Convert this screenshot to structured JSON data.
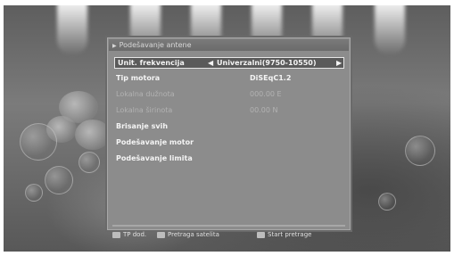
{
  "dialog": {
    "title": "Podešavanje antene"
  },
  "rows": [
    {
      "label": "Unit. frekvencija",
      "value": "Univerzalni(9750-10550)",
      "state": "selected"
    },
    {
      "label": "Tip motora",
      "value": "DiSEqC1.2",
      "state": "normal"
    },
    {
      "label": "Lokalna dužnota",
      "value": "000.00 E",
      "state": "disabled"
    },
    {
      "label": "Lokalna širinota",
      "value": "00.00 N",
      "state": "disabled"
    },
    {
      "label": "Brisanje svih",
      "value": "",
      "state": "normal"
    },
    {
      "label": "Podešavanje motor",
      "value": "",
      "state": "normal"
    },
    {
      "label": "Podešavanje limita",
      "value": "",
      "state": "normal"
    }
  ],
  "footer": {
    "tp_label": "TP dod.",
    "sat_label": "Pretraga satelita",
    "start_label": "Start pretrage"
  },
  "colors": {
    "dialog_bg": "#8c8c8c",
    "selected_bg": "#5a5a5a",
    "text": "#f4f4f4"
  }
}
